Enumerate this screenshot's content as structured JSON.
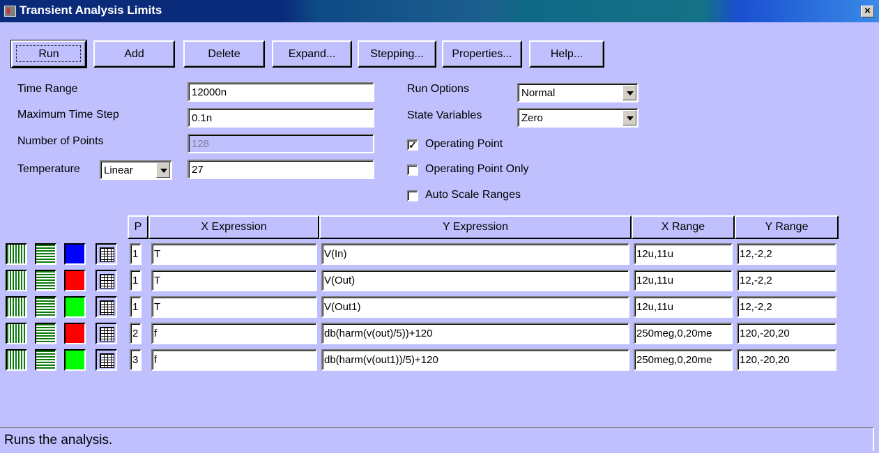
{
  "window": {
    "title": "Transient Analysis Limits",
    "close_label": "×"
  },
  "toolbar": [
    {
      "label": "Run",
      "ul": "R"
    },
    {
      "label": "Add",
      "ul": "A"
    },
    {
      "label": "Delete",
      "ul": "D"
    },
    {
      "label": "Expand...",
      "ul": ""
    },
    {
      "label": "Stepping...",
      "ul": ""
    },
    {
      "label": "Properties...",
      "ul": ""
    },
    {
      "label": "Help...",
      "ul": "H"
    }
  ],
  "params": {
    "time_range_label": "Time Range",
    "time_range": "12000n",
    "max_step_label": "Maximum Time Step",
    "max_step": "0.1n",
    "num_points_label": "Number of Points",
    "num_points": "128",
    "temperature_label": "Temperature",
    "temperature_mode": "Linear",
    "temperature": "27"
  },
  "options": {
    "run_options_label": "Run Options",
    "run_options_value": "Normal",
    "state_vars_label": "State Variables",
    "state_vars_value": "Zero",
    "operating_point_label": "Operating Point",
    "operating_point_checked": true,
    "operating_point_only_label": "Operating Point Only",
    "operating_point_only_checked": false,
    "auto_scale_label": "Auto Scale Ranges",
    "auto_scale_checked": false
  },
  "table": {
    "headers": {
      "p": "P",
      "x": "X Expression",
      "y": "Y Expression",
      "xr": "X Range",
      "yr": "Y Range"
    },
    "rows": [
      {
        "color": "#0000ff",
        "p": "1",
        "x": "T",
        "y": "V(In)",
        "xr": "12u,11u",
        "yr": "12,-2,2"
      },
      {
        "color": "#ff0000",
        "p": "1",
        "x": "T",
        "y": "V(Out)",
        "xr": "12u,11u",
        "yr": "12,-2,2"
      },
      {
        "color": "#00ff00",
        "p": "1",
        "x": "T",
        "y": "V(Out1)",
        "xr": "12u,11u",
        "yr": "12,-2,2"
      },
      {
        "color": "#ff0000",
        "p": "2",
        "x": "f",
        "y": "db(harm(v(out)/5))+120",
        "xr": "250meg,0,20me",
        "yr": "120,-20,20"
      },
      {
        "color": "#00ff00",
        "p": "3",
        "x": "f",
        "y": "db(harm(v(out1))/5)+120",
        "xr": "250meg,0,20me",
        "yr": "120,-20,20"
      }
    ]
  },
  "status": "Runs the analysis."
}
